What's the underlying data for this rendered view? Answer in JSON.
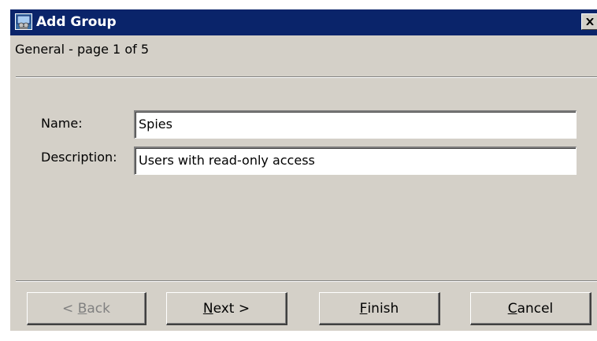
{
  "window": {
    "title": "Add Group",
    "icon": "group-window-icon",
    "close_icon": "close-icon"
  },
  "wizard": {
    "page_label": "General - page 1 of 5"
  },
  "form": {
    "name_label": "Name:",
    "name_value": "Spies",
    "description_label": "Description:",
    "description_value": "Users with read-only access"
  },
  "buttons": {
    "back": {
      "prefix": "< ",
      "accel": "B",
      "rest": "ack",
      "enabled": false
    },
    "next": {
      "prefix": "",
      "accel": "N",
      "rest": "ext >",
      "enabled": true
    },
    "finish": {
      "prefix": "",
      "accel": "F",
      "rest": "inish",
      "enabled": true
    },
    "cancel": {
      "prefix": "",
      "accel": "C",
      "rest": "ancel",
      "enabled": true
    }
  },
  "colors": {
    "titlebar": "#0a246a",
    "dialog_face": "#d4d0c8",
    "disabled_text": "#808080"
  }
}
